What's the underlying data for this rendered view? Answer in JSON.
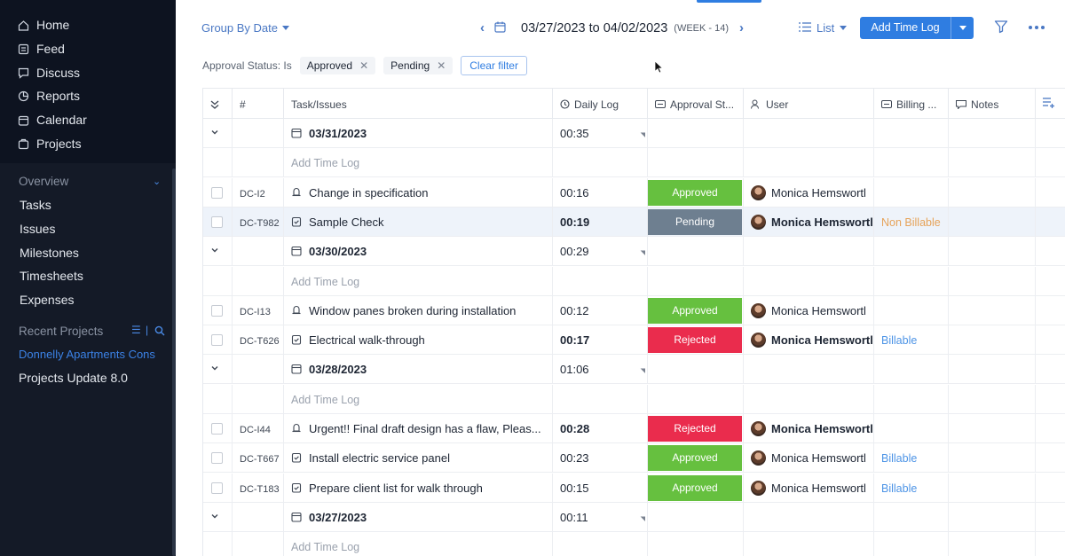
{
  "sidebar": {
    "nav": [
      {
        "label": "Home",
        "icon": "home-icon"
      },
      {
        "label": "Feed",
        "icon": "feed-icon"
      },
      {
        "label": "Discuss",
        "icon": "discuss-icon"
      },
      {
        "label": "Reports",
        "icon": "reports-icon"
      },
      {
        "label": "Calendar",
        "icon": "calendar-icon"
      },
      {
        "label": "Projects",
        "icon": "projects-icon"
      }
    ],
    "overview_label": "Overview",
    "overview_items": [
      "Tasks",
      "Issues",
      "Milestones",
      "Timesheets",
      "Expenses"
    ],
    "recent_label": "Recent Projects",
    "recent_projects": [
      {
        "label": "Donnelly Apartments Cons",
        "active": true
      },
      {
        "label": "Projects Update 8.0",
        "active": false
      }
    ]
  },
  "toolbar": {
    "group_by": "Group By Date",
    "date_range": "03/27/2023 to 04/02/2023",
    "week": "(WEEK - 14)",
    "view": "List",
    "add_button": "Add Time Log"
  },
  "filters": {
    "label": "Approval Status: Is",
    "chips": [
      "Approved",
      "Pending"
    ],
    "clear": "Clear filter"
  },
  "columns": {
    "num": "#",
    "task": "Task/Issues",
    "daily_log": "Daily Log",
    "approval": "Approval St...",
    "user": "User",
    "billing": "Billing ...",
    "notes": "Notes"
  },
  "add_time_log_text": "Add Time Log",
  "groups": [
    {
      "date": "03/31/2023",
      "total": "00:35",
      "entries": [
        {
          "id": "DC-I2",
          "type": "issue",
          "title": "Change in specification",
          "log": "00:16",
          "status": "Approved",
          "user": "Monica Hemswortl",
          "billing": "",
          "bold": false
        },
        {
          "id": "DC-T982",
          "type": "task",
          "title": "Sample Check",
          "log": "00:19",
          "status": "Pending",
          "user": "Monica Hemswortl",
          "billing": "Non Billable",
          "bold": true
        }
      ]
    },
    {
      "date": "03/30/2023",
      "total": "00:29",
      "entries": [
        {
          "id": "DC-I13",
          "type": "issue",
          "title": "Window panes broken during installation",
          "log": "00:12",
          "status": "Approved",
          "user": "Monica Hemswortl",
          "billing": "",
          "bold": false
        },
        {
          "id": "DC-T626",
          "type": "task",
          "title": "Electrical walk-through",
          "log": "00:17",
          "status": "Rejected",
          "user": "Monica Hemswortl",
          "billing": "Billable",
          "bold": true
        }
      ]
    },
    {
      "date": "03/28/2023",
      "total": "01:06",
      "entries": [
        {
          "id": "DC-I44",
          "type": "issue",
          "title": "Urgent!! Final draft design has a flaw, Pleas...",
          "log": "00:28",
          "status": "Rejected",
          "user": "Monica Hemswortl",
          "billing": "",
          "bold": true
        },
        {
          "id": "DC-T667",
          "type": "task",
          "title": "Install electric service panel",
          "log": "00:23",
          "status": "Approved",
          "user": "Monica Hemswortl",
          "billing": "Billable",
          "bold": false
        },
        {
          "id": "DC-T183",
          "type": "task",
          "title": "Prepare client list for walk through",
          "log": "00:15",
          "status": "Approved",
          "user": "Monica Hemswortl",
          "billing": "Billable",
          "bold": false
        }
      ]
    },
    {
      "date": "03/27/2023",
      "total": "00:11",
      "entries": []
    }
  ],
  "colors": {
    "accent": "#2f7de1",
    "approved": "#66c03f",
    "pending": "#6e7f90",
    "rejected": "#ea2c4d",
    "sidebar_bg": "#141a27"
  }
}
